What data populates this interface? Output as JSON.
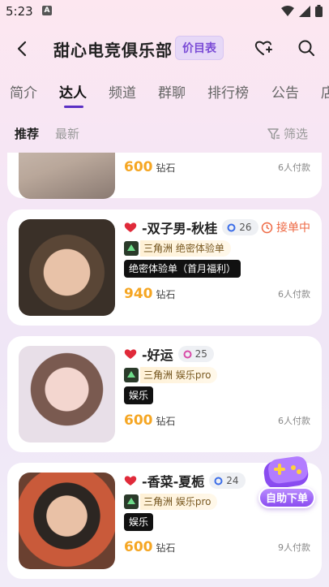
{
  "status_bar": {
    "time": "5:23",
    "notification_glyph": "A"
  },
  "header": {
    "title": "甜心电竞俱乐部",
    "price_list_label": "价目表",
    "back_icon": "chevron-left-icon",
    "favorite_icon": "heart-plus-icon",
    "search_icon": "search-icon"
  },
  "tabs": [
    "简介",
    "达人",
    "频道",
    "群聊",
    "排行榜",
    "公告",
    "店"
  ],
  "active_tab": "达人",
  "filter": {
    "recommend": "推荐",
    "latest": "最新",
    "filter_label": "筛选"
  },
  "colors": {
    "accent": "#5a2fc4",
    "price": "#f5a623",
    "status": "#ee6a45"
  },
  "cards": [
    {
      "name": "",
      "rank": "",
      "status": "",
      "game": "",
      "service": "",
      "tag": "",
      "price": "600",
      "unit": "钻石",
      "paid": "6人付款"
    },
    {
      "name": "-双子男-秋桂",
      "rank": "26",
      "status": "接单中",
      "game": "三角洲",
      "service": "绝密体验单",
      "tag": "绝密体验单（首月福利）",
      "price": "940",
      "unit": "钻石",
      "paid": "6人付款"
    },
    {
      "name": "-好运",
      "rank": "25",
      "status": "",
      "game": "三角洲",
      "service": "娱乐pro",
      "tag": "娱乐",
      "price": "600",
      "unit": "钻石",
      "paid": "6人付款"
    },
    {
      "name": "-香菜-夏栀",
      "rank": "24",
      "status": "",
      "game": "三角洲",
      "service": "娱乐pro",
      "tag": "娱乐",
      "price": "600",
      "unit": "钻石",
      "paid": "9人付款"
    }
  ],
  "float_button": {
    "label": "自助下单"
  }
}
